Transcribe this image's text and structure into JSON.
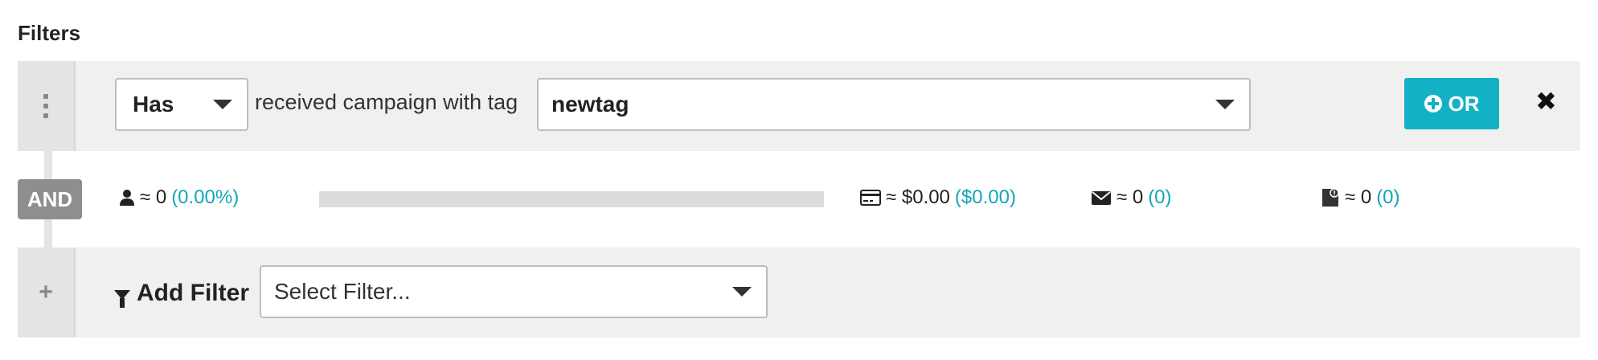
{
  "section_title": "Filters",
  "condition": {
    "operator": "Has",
    "phrase": "received campaign with tag",
    "tag": "newtag",
    "or_label": "OR"
  },
  "and_label": "AND",
  "stats": {
    "contacts": {
      "approx": "≈ 0",
      "pct": "(0.00%)"
    },
    "progress": 0,
    "revenue": {
      "approx": "≈ $0.00",
      "sub": "($0.00)"
    },
    "emails": {
      "approx": "≈ 0",
      "sub": "(0)"
    },
    "other": {
      "approx": "≈ 0",
      "sub": "(0)"
    }
  },
  "add_filter": {
    "label": "Add Filter",
    "placeholder": "Select Filter..."
  },
  "icons": {
    "drag": "drag-handle-icon",
    "plus": "plus-icon",
    "or_plus": "plus-circle-icon",
    "close": "close-icon",
    "user": "user-icon",
    "card": "credit-card-icon",
    "mail": "envelope-icon",
    "other": "document-alert-icon",
    "filter": "funnel-icon"
  },
  "colors": {
    "accent": "#13b1c5",
    "panel": "#f0f0f0",
    "badge": "#8e8e8e"
  }
}
